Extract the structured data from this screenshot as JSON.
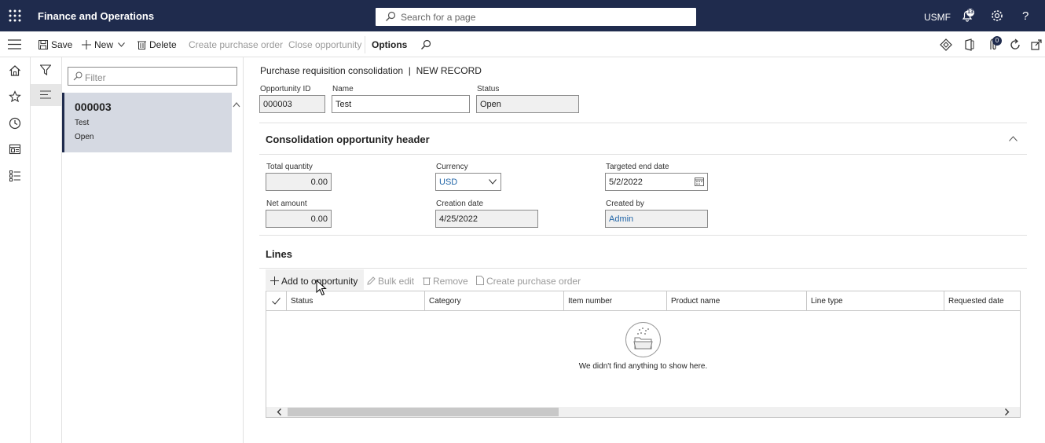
{
  "topbar": {
    "app_title": "Finance and Operations",
    "search_placeholder": "Search for a page",
    "company": "USMF",
    "notification_count": "13",
    "help_label": "?"
  },
  "actions": {
    "save": "Save",
    "new": "New",
    "delete": "Delete",
    "create_po": "Create purchase order",
    "close_opportunity": "Close opportunity",
    "options": "Options",
    "attachment_count": "0"
  },
  "list": {
    "filter_placeholder": "Filter",
    "records": [
      {
        "id": "000003",
        "name": "Test",
        "status": "Open"
      }
    ]
  },
  "form": {
    "breadcrumb": "Purchase requisition consolidation  |  NEW RECORD",
    "opportunity_id_label": "Opportunity ID",
    "opportunity_id": "000003",
    "name_label": "Name",
    "name": "Test",
    "status_label": "Status",
    "status": "Open"
  },
  "header_card": {
    "title": "Consolidation opportunity header",
    "total_quantity_label": "Total quantity",
    "total_quantity": "0.00",
    "currency_label": "Currency",
    "currency": "USD",
    "targeted_end_date_label": "Targeted end date",
    "targeted_end_date": "5/2/2022",
    "net_amount_label": "Net amount",
    "net_amount": "0.00",
    "creation_date_label": "Creation date",
    "creation_date": "4/25/2022",
    "created_by_label": "Created by",
    "created_by": "Admin"
  },
  "lines": {
    "title": "Lines",
    "add": "Add to opportunity",
    "bulk_edit": "Bulk edit",
    "remove": "Remove",
    "create_po": "Create purchase order",
    "columns": [
      "Status",
      "Category",
      "Item number",
      "Product name",
      "Line type",
      "Requested date"
    ],
    "empty_message": "We didn't find anything to show here."
  }
}
